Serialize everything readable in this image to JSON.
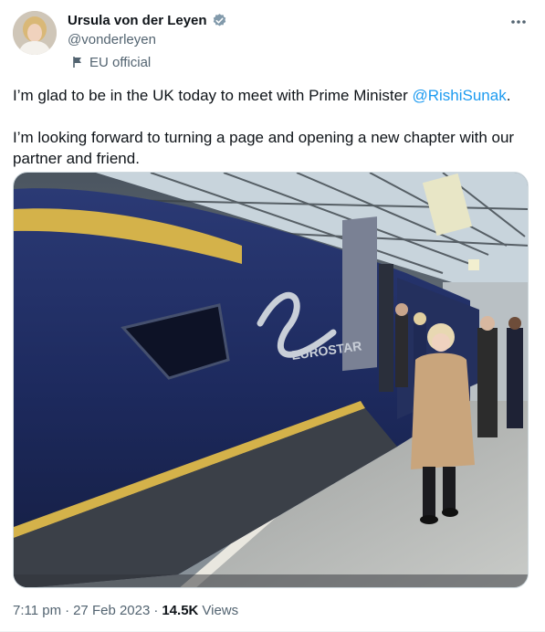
{
  "author": {
    "display_name": "Ursula von der Leyen",
    "handle": "@vonderleyen",
    "affiliation": "EU official",
    "verified_icon": "verified-badge-icon",
    "affiliation_icon": "flag-icon"
  },
  "tweet": {
    "line1_prefix": "I’m glad to be in the UK today to meet with Prime Minister ",
    "mention": "@RishiSunak",
    "line1_suffix": ".",
    "line2": "I’m looking forward to turning a page and opening a new chapter with our partner and friend."
  },
  "media": {
    "logo_text": "EUROSTAR"
  },
  "meta": {
    "time": "7:11 pm",
    "separator1": "·",
    "date": "27 Feb 2023",
    "separator2": "·",
    "views_count": "14.5K",
    "views_label": "Views"
  },
  "colors": {
    "link": "#1d9bf0",
    "secondary_text": "#536471",
    "verified": "#829aab"
  }
}
